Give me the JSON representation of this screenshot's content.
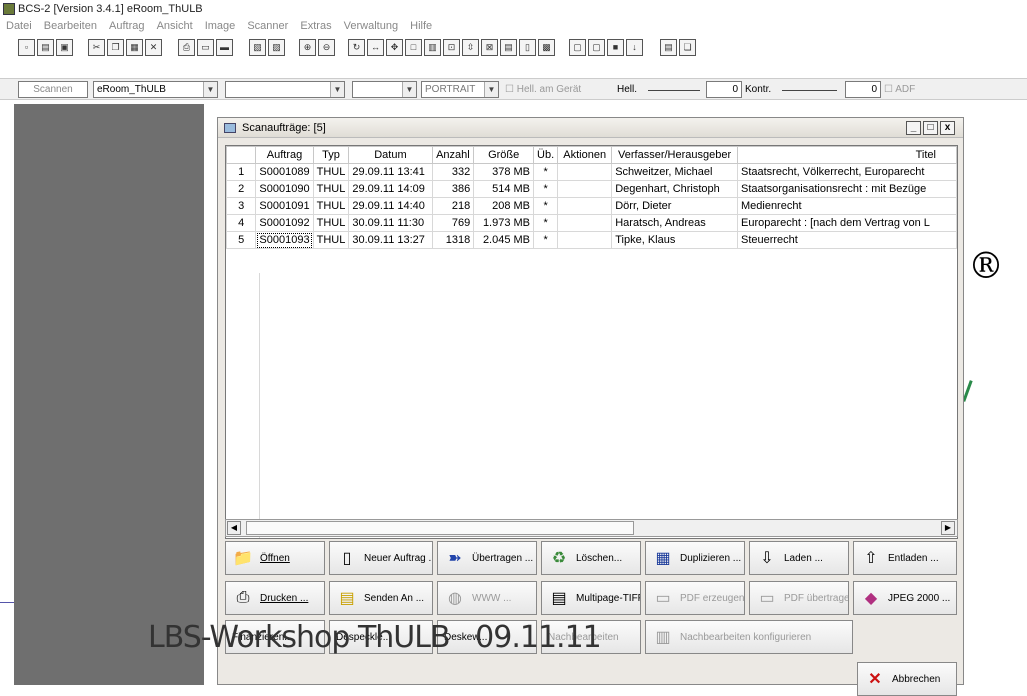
{
  "window": {
    "title": "BCS-2 [Version 3.4.1] eRoom_ThULB"
  },
  "menu": [
    "Datei",
    "Bearbeiten",
    "Auftrag",
    "Ansicht",
    "Image",
    "Scanner",
    "Extras",
    "Verwaltung",
    "Hilfe"
  ],
  "toolbar2": {
    "scan_button": "Scannen",
    "profile_value": "eRoom_ThULB",
    "orientation_value": "PORTRAIT",
    "hell_am_geraet_label": "Hell. am Gerät",
    "hell_label": "Hell.",
    "hell_value": "0",
    "kontr_label": "Kontr.",
    "kontr_value": "0",
    "adf_label": "ADF"
  },
  "dialog": {
    "title": "Scanaufträge: [5]",
    "minimize": "_",
    "maximize": "□",
    "close": "x"
  },
  "table": {
    "headers": [
      "",
      "Auftrag",
      "Typ",
      "Datum",
      "Anzahl",
      "Größe",
      "Üb.",
      "Aktionen",
      "Verfasser/Herausgeber",
      "Titel"
    ],
    "rows": [
      [
        "1",
        "S0001089",
        "THUL",
        "29.09.11 13:41",
        "332",
        "378 MB",
        "*",
        "",
        "Schweitzer, Michael",
        "Staatsrecht, Völkerrecht, Europarecht"
      ],
      [
        "2",
        "S0001090",
        "THUL",
        "29.09.11 14:09",
        "386",
        "514 MB",
        "*",
        "",
        "Degenhart, Christoph",
        "Staatsorganisationsrecht : mit Bezüge"
      ],
      [
        "3",
        "S0001091",
        "THUL",
        "29.09.11 14:40",
        "218",
        "208 MB",
        "*",
        "",
        "Dörr, Dieter",
        "Medienrecht"
      ],
      [
        "4",
        "S0001092",
        "THUL",
        "30.09.11 11:30",
        "769",
        "1.973 MB",
        "*",
        "",
        "Haratsch, Andreas",
        "Europarecht : [nach dem Vertrag von L"
      ],
      [
        "5",
        "S0001093",
        "THUL",
        "30.09.11 13:27",
        "1318",
        "2.045 MB",
        "*",
        "",
        "Tipke, Klaus",
        "Steuerrecht"
      ]
    ]
  },
  "buttons": {
    "oeffnen": "Öffnen",
    "neuer_auftrag": "Neuer Auftrag ...",
    "uebertragen": "Übertragen ...",
    "loeschen": "Löschen...",
    "duplizieren": "Duplizieren ...",
    "laden": "Laden ...",
    "entladen": "Entladen ...",
    "drucken": "Drucken ...",
    "senden_an": "Senden An ...",
    "www": "WWW ...",
    "multipage": "Multipage-TIFF...",
    "pdf_erzeugen": "PDF erzeugen ...",
    "pdf_uebertragen": "PDF übertragen...",
    "jpeg2000": "JPEG 2000 ...",
    "finanzieren": "Finanzieren...",
    "despeckle": "Despeckle...",
    "deskew": "Deskew...",
    "nachbearbeiten": "Nachbearbeiten",
    "nachbearbeiten_konfig": "Nachbearbeiten konfigurieren",
    "abbrechen": "Abbrechen"
  },
  "overlay_text": "LBS-Workshop ThULB   09.11.11",
  "side_mark": "®"
}
